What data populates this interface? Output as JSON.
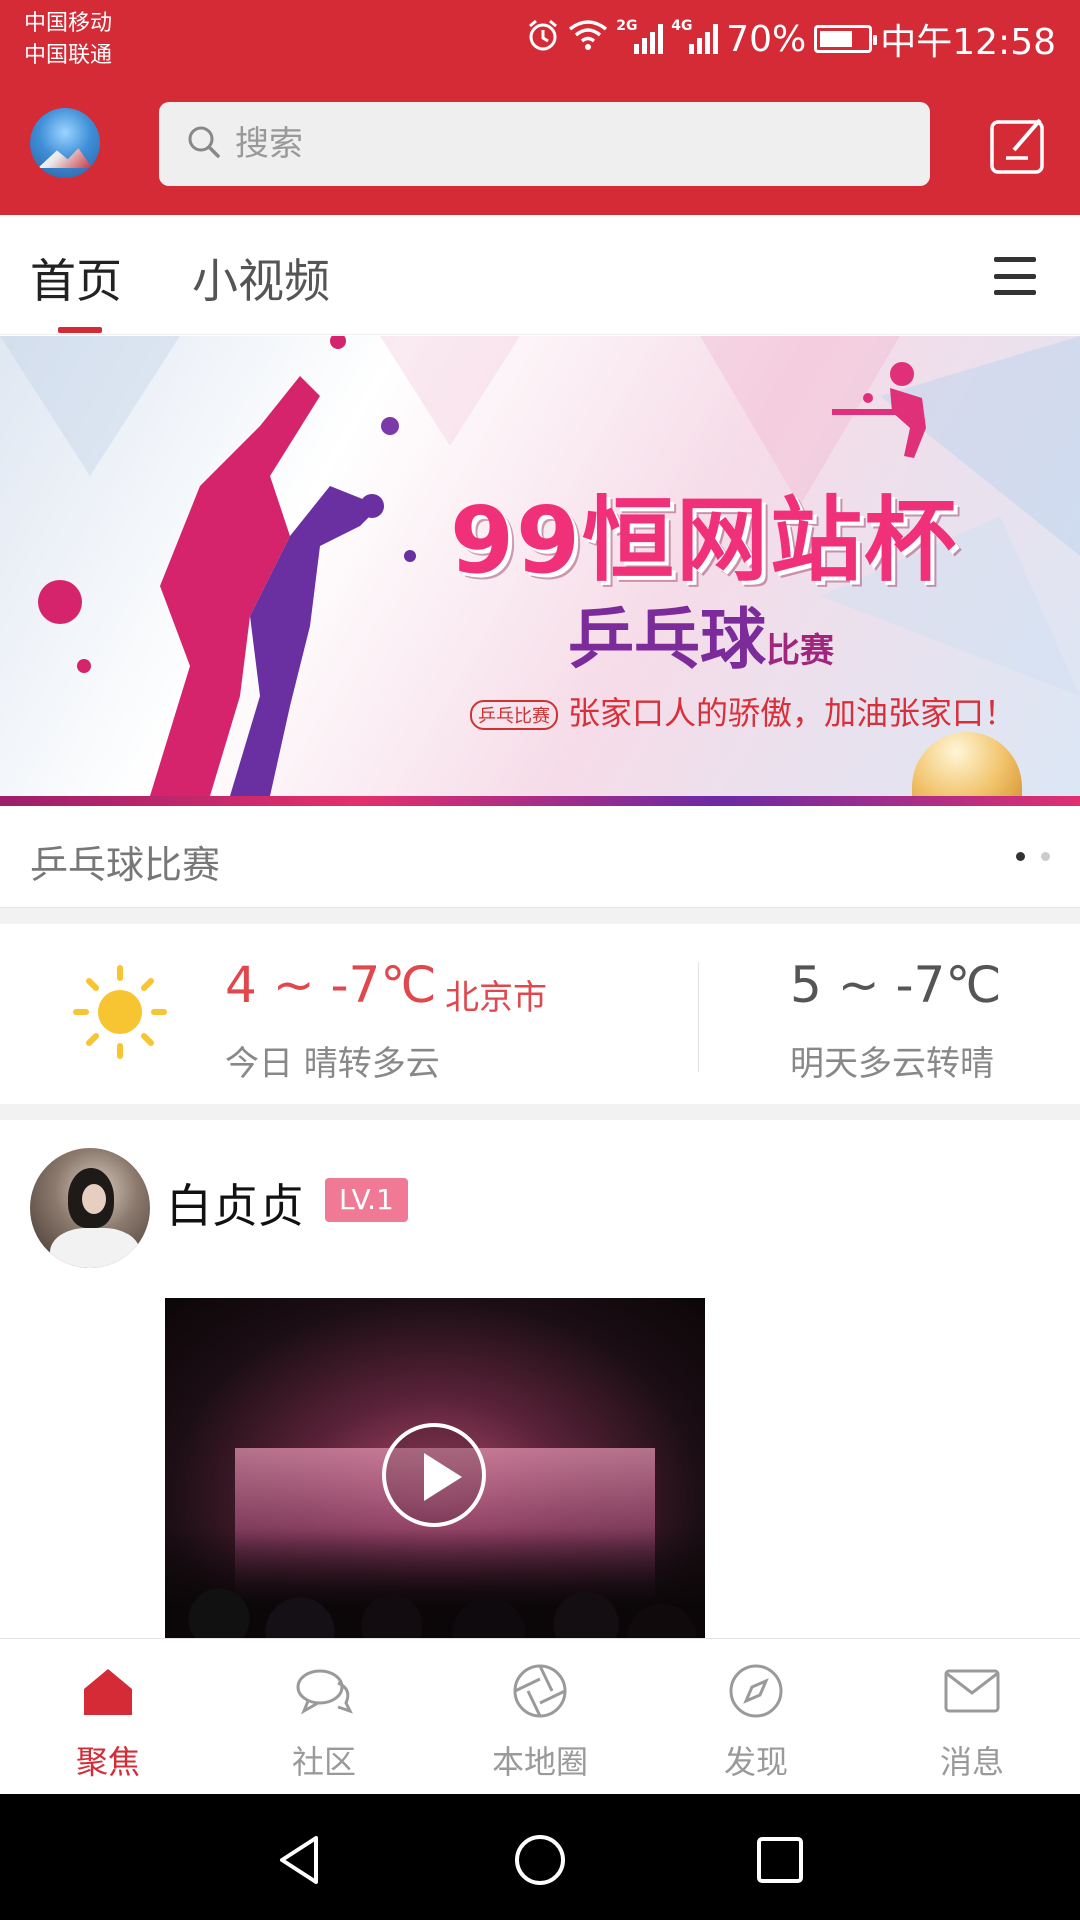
{
  "status_bar": {
    "carrier_1": "中国移动",
    "carrier_2": "中国联通",
    "signal_1_tag": "2G",
    "signal_2_tag": "4G",
    "battery_text": "70%",
    "battery_level": 0.7,
    "time": "中午12:58"
  },
  "header": {
    "search_placeholder": "搜索",
    "icons": [
      "app-logo",
      "search-icon",
      "edit-icon"
    ]
  },
  "tabs": {
    "items": [
      {
        "label": "首页",
        "active": true
      },
      {
        "label": "小视频",
        "active": false
      }
    ],
    "menu_icon": "menu-icon"
  },
  "banner": {
    "title": "99恒网站杯",
    "subtitle_main": "乒乓球",
    "subtitle_small": "比赛",
    "badge": "乒乓比赛",
    "slogan": "张家口人的骄傲，加油张家口！",
    "caption": "乒乓球比赛",
    "dots_total": 2,
    "dot_active": 1
  },
  "weather": {
    "today_temp": "4 ~ -7℃",
    "city": "北京市",
    "today_desc": "今日 晴转多云",
    "tomorrow_temp": "5 ~ -7℃",
    "tomorrow_desc": "明天多云转晴",
    "icon": "sun-icon"
  },
  "post": {
    "username": "白贞贞",
    "level": "LV.1"
  },
  "bottom_nav": {
    "items": [
      {
        "label": "聚焦",
        "icon": "home-icon",
        "active": true
      },
      {
        "label": "社区",
        "icon": "chat-icon",
        "active": false
      },
      {
        "label": "本地圈",
        "icon": "aperture-icon",
        "active": false
      },
      {
        "label": "发现",
        "icon": "compass-icon",
        "active": false
      },
      {
        "label": "消息",
        "icon": "mail-icon",
        "active": false
      }
    ]
  },
  "colors": {
    "brand": "#D42B36",
    "level_badge": "#F07A95",
    "temp_today": "#E0484E"
  }
}
